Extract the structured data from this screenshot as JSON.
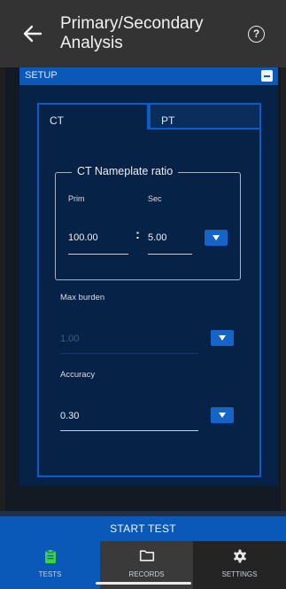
{
  "header": {
    "title": "Primary/Secondary Analysis",
    "back_icon": "back-arrow-icon",
    "help_icon": "help-icon",
    "help_glyph": "?"
  },
  "setup": {
    "label": "SETUP",
    "toggle_icon": "collapse-icon"
  },
  "tabs": [
    {
      "label": "CT",
      "active": true
    },
    {
      "label": "PT",
      "active": false
    }
  ],
  "nameplate": {
    "title": "CT Nameplate ratio",
    "prim_label": "Prim",
    "sec_label": "Sec",
    "prim_value": "100.00",
    "separator": ":",
    "sec_value": "5.00"
  },
  "max_burden": {
    "label": "Max burden",
    "value": "1.00",
    "enabled": false
  },
  "accuracy": {
    "label": "Accuracy",
    "value": "0.30"
  },
  "start_test_label": "START TEST",
  "nav": [
    {
      "label": "TESTS",
      "icon": "clipboard-icon",
      "active": true
    },
    {
      "label": "RECORDS",
      "icon": "folder-icon",
      "active": false
    },
    {
      "label": "SETTINGS",
      "icon": "gear-icon",
      "active": false
    }
  ],
  "colors": {
    "accent": "#0a59b8",
    "panel": "#072247",
    "active_icon": "#3fd23f"
  }
}
